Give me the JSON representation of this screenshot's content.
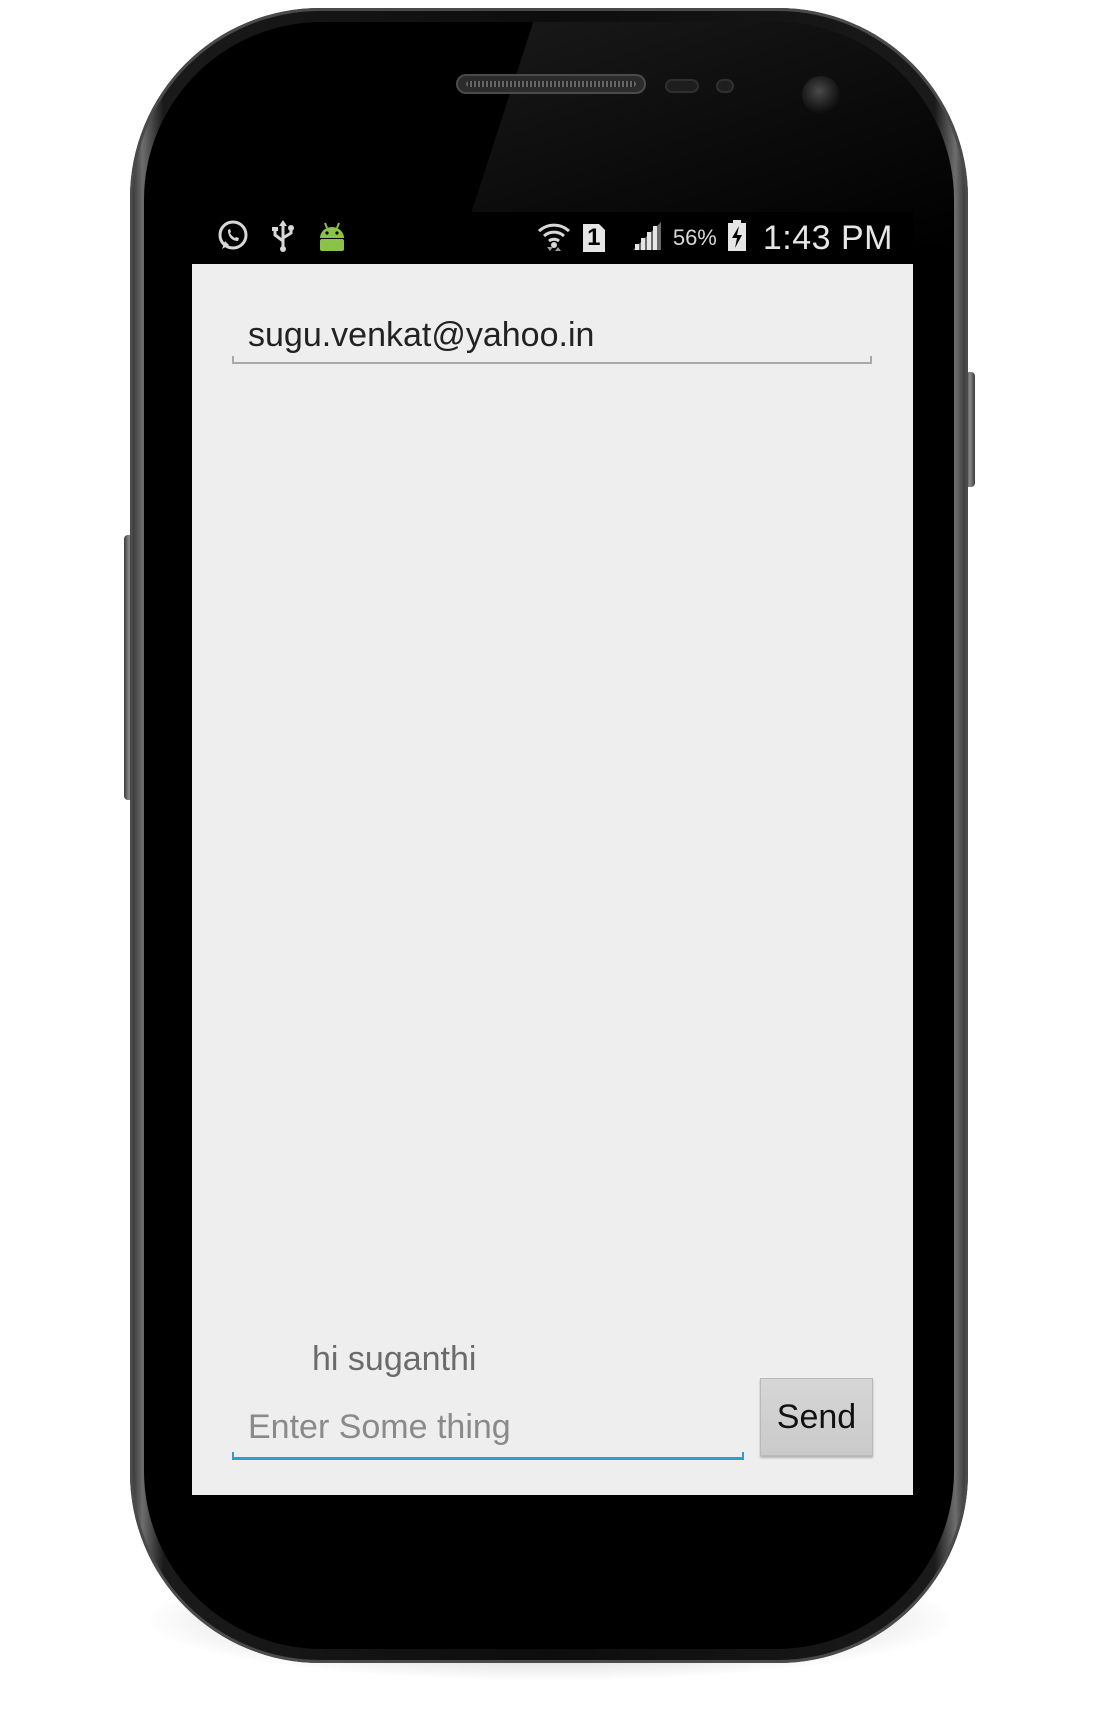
{
  "status_bar": {
    "icons_left": [
      "whatsapp-icon",
      "usb-icon",
      "android-icon"
    ],
    "icons_right": [
      "wifi-icon",
      "sim-icon",
      "signal-icon",
      "battery-icon"
    ],
    "sim_slot": "1",
    "battery_percent": "56%",
    "time": "1:43 PM"
  },
  "compose": {
    "to_value": "sugu.venkat@yahoo.in",
    "message_text": "hi suganthi",
    "input_placeholder": "Enter Some thing",
    "input_value": "",
    "send_label": "Send"
  },
  "colors": {
    "screen_bg": "#eeeeee",
    "statusbar_bg": "#000000",
    "accent": "#2a9fd6",
    "android_green": "#8bc34a"
  }
}
